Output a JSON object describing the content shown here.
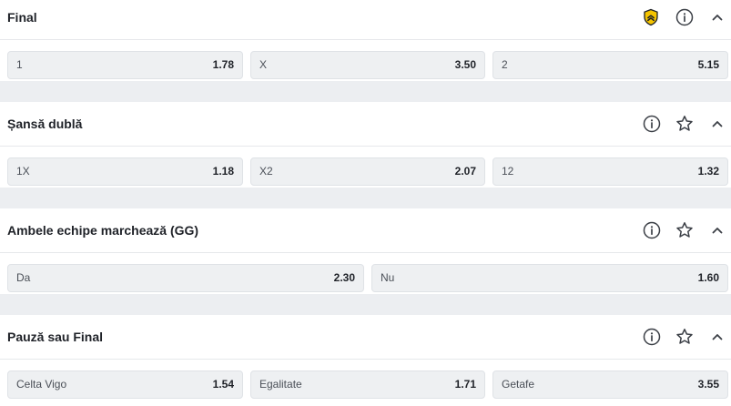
{
  "markets": [
    {
      "title": "Final",
      "outcomes": [
        {
          "label": "1",
          "odd": "1.78"
        },
        {
          "label": "X",
          "odd": "3.50"
        },
        {
          "label": "2",
          "odd": "5.15"
        }
      ]
    },
    {
      "title": "Șansă dublă",
      "outcomes": [
        {
          "label": "1X",
          "odd": "1.18"
        },
        {
          "label": "X2",
          "odd": "2.07"
        },
        {
          "label": "12",
          "odd": "1.32"
        }
      ]
    },
    {
      "title": "Ambele echipe marchează (GG)",
      "outcomes": [
        {
          "label": "Da",
          "odd": "2.30"
        },
        {
          "label": "Nu",
          "odd": "1.60"
        }
      ]
    },
    {
      "title": "Pauză sau Final",
      "outcomes": [
        {
          "label": "Celta Vigo",
          "odd": "1.54"
        },
        {
          "label": "Egalitate",
          "odd": "1.71"
        },
        {
          "label": "Getafe",
          "odd": "3.55"
        }
      ]
    }
  ],
  "icons": {
    "featured": "shield-chevrons-icon",
    "info": "info-icon",
    "favorite": "star-icon",
    "collapse": "chevron-up-icon"
  },
  "colors": {
    "featured_badge": "#f5c400",
    "odd_background": "#eef0f2",
    "page_background": "#eceef1"
  }
}
